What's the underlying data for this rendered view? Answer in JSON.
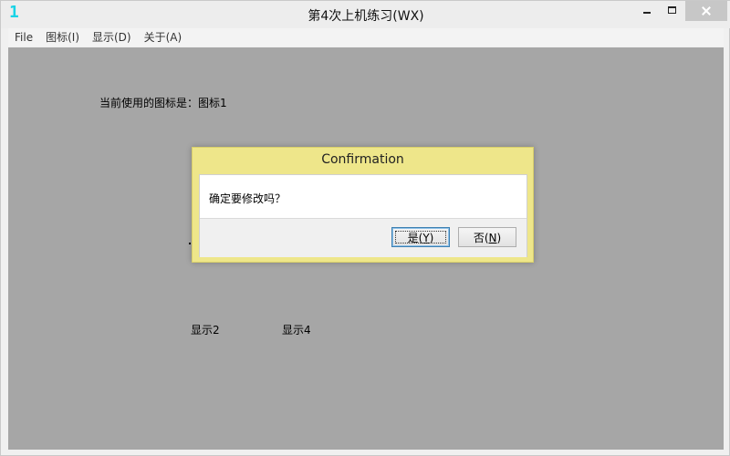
{
  "window": {
    "app_icon_text": "1",
    "title": "第4次上机练习(WX)"
  },
  "menubar": {
    "items": [
      {
        "label": "File"
      },
      {
        "label": "图标(I)"
      },
      {
        "label": "显示(D)"
      },
      {
        "label": "关于(A)"
      }
    ]
  },
  "client": {
    "current_icon_label": "当前使用的图标是：图标1",
    "display2_label": "显示2",
    "display4_label": "显示4",
    "background_color": "#a6a6a6"
  },
  "dialog": {
    "title": "Confirmation",
    "message": "确定要修改吗？",
    "yes_button": {
      "text": "是",
      "mnemonic": "Y"
    },
    "no_button": {
      "text": "否",
      "mnemonic": "N"
    },
    "title_bar_color": "#eee68a"
  },
  "icons": {
    "minimize": "minimize-icon",
    "maximize": "maximize-icon",
    "close": "close-icon"
  }
}
